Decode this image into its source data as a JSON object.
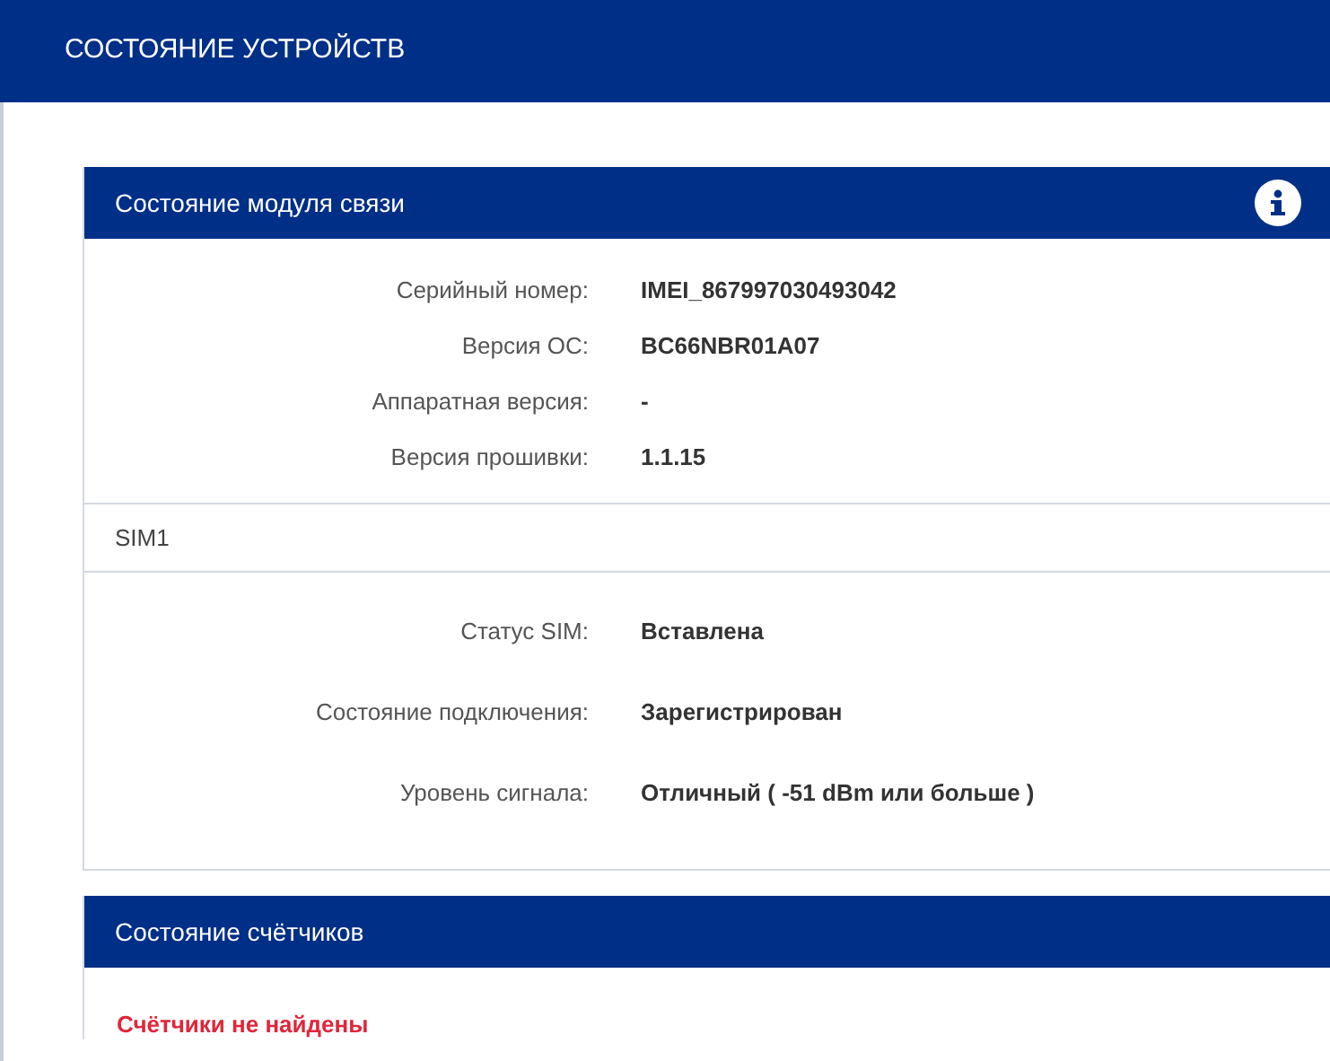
{
  "header": {
    "title": "СОСТОЯНИЕ УСТРОЙСТВ"
  },
  "module_panel": {
    "title": "Состояние модуля связи",
    "rows": [
      {
        "label": "Серийный номер:",
        "value": "IMEI_867997030493042"
      },
      {
        "label": "Версия ОС:",
        "value": "BC66NBR01A07"
      },
      {
        "label": "Аппаратная версия:",
        "value": "-"
      },
      {
        "label": "Версия прошивки:",
        "value": "1.1.15"
      }
    ],
    "sim": {
      "title": "SIM1",
      "rows": [
        {
          "label": "Статус SIM:",
          "value": "Вставлена"
        },
        {
          "label": "Состояние подключения:",
          "value": "Зарегистрирован"
        },
        {
          "label": "Уровень сигнала:",
          "value": "Отличный ( -51 dBm или больше )"
        }
      ]
    }
  },
  "meters_panel": {
    "title": "Состояние счётчиков",
    "message": {
      "kind": "error",
      "text": "Счётчики не найдены"
    }
  }
}
